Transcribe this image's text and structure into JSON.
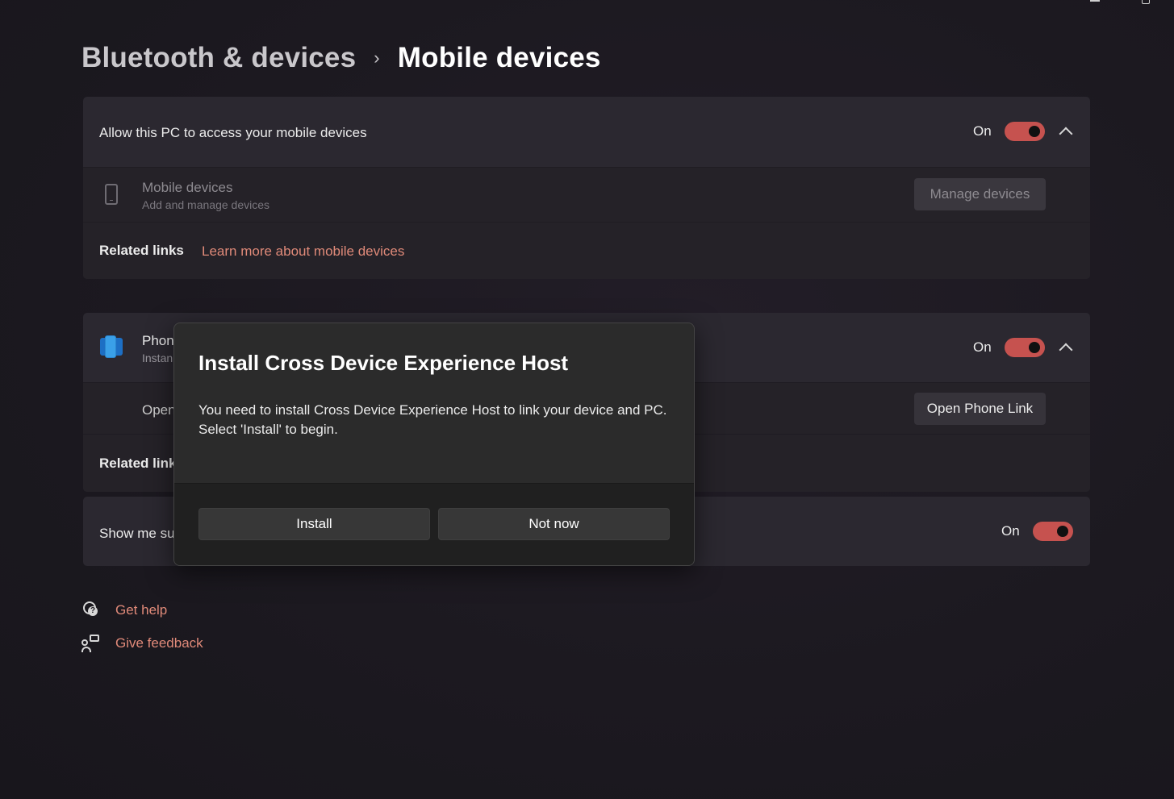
{
  "window_controls": {
    "minimize_icon": "minimize-icon",
    "restore_icon": "restore-icon"
  },
  "breadcrumb": {
    "parent": "Bluetooth & devices",
    "separator": "›",
    "current": "Mobile devices"
  },
  "card1": {
    "header_label": "Allow this PC to access your mobile devices",
    "toggle_state": "On",
    "mobile_devices_title": "Mobile devices",
    "mobile_devices_subtitle": "Add and manage devices",
    "manage_button": "Manage devices",
    "related_links_label": "Related links",
    "learn_more_link": "Learn more about mobile devices"
  },
  "card2": {
    "title_partial": "Phon",
    "subtitle_partial": "Instan",
    "toggle_state": "On",
    "open_partial": "Open",
    "open_button": "Open Phone Link",
    "related_links_partial": "Related link"
  },
  "card3": {
    "label_partial": "Show me su",
    "toggle_state": "On"
  },
  "footer": {
    "get_help": "Get help",
    "give_feedback": "Give feedback"
  },
  "dialog": {
    "title": "Install Cross Device Experience Host",
    "body_line1": "You need to install Cross Device Experience Host to link your device and PC.",
    "body_line2": "Select 'Install' to begin.",
    "install_button": "Install",
    "not_now_button": "Not now"
  },
  "colors": {
    "accent_toggle": "#c6524f",
    "link": "#e08a79",
    "background": "#1d1a22"
  }
}
